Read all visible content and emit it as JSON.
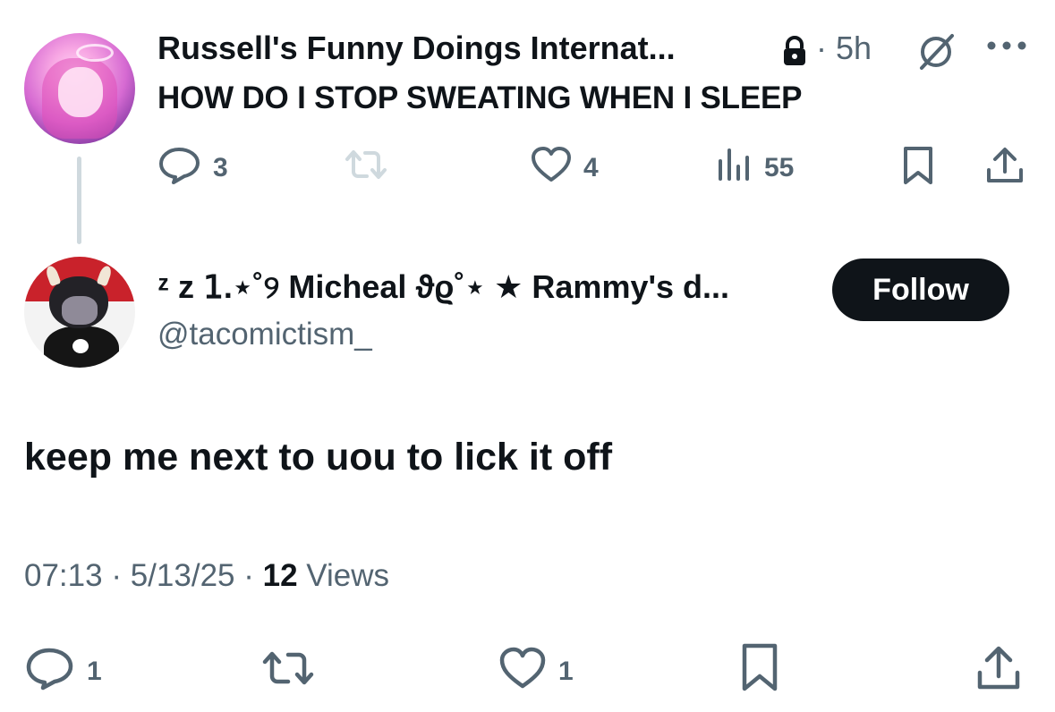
{
  "parent_tweet": {
    "author_name": "Russell's Funny Doings Internat...",
    "separator": "·",
    "time_ago": "5h",
    "text": "HOW DO I STOP SWEATING WHEN I SLEEP",
    "actions": {
      "replies": "3",
      "likes": "4",
      "views": "55"
    }
  },
  "reply_tweet": {
    "author_name": "ᶻ z 𝟣.⋆˚୨ Micheal ϑϱ˚⋆ ★ Rammy's d...",
    "handle": "@tacomictism_",
    "follow_label": "Follow",
    "text": "keep me next to uou to lick it off",
    "time": "07:13",
    "date": "5/13/25",
    "views_count": "12",
    "views_label": "Views",
    "separator": "·",
    "actions": {
      "replies": "1",
      "likes": "1"
    }
  },
  "icons": [
    "lock-icon",
    "grok-icon",
    "more-icon",
    "reply-icon",
    "retweet-icon",
    "like-icon",
    "views-icon",
    "bookmark-icon",
    "share-icon"
  ],
  "colors": {
    "text": "#0f1419",
    "secondary": "#536471",
    "follow_bg": "#0f1419",
    "thread_line": "#cfd9de"
  }
}
